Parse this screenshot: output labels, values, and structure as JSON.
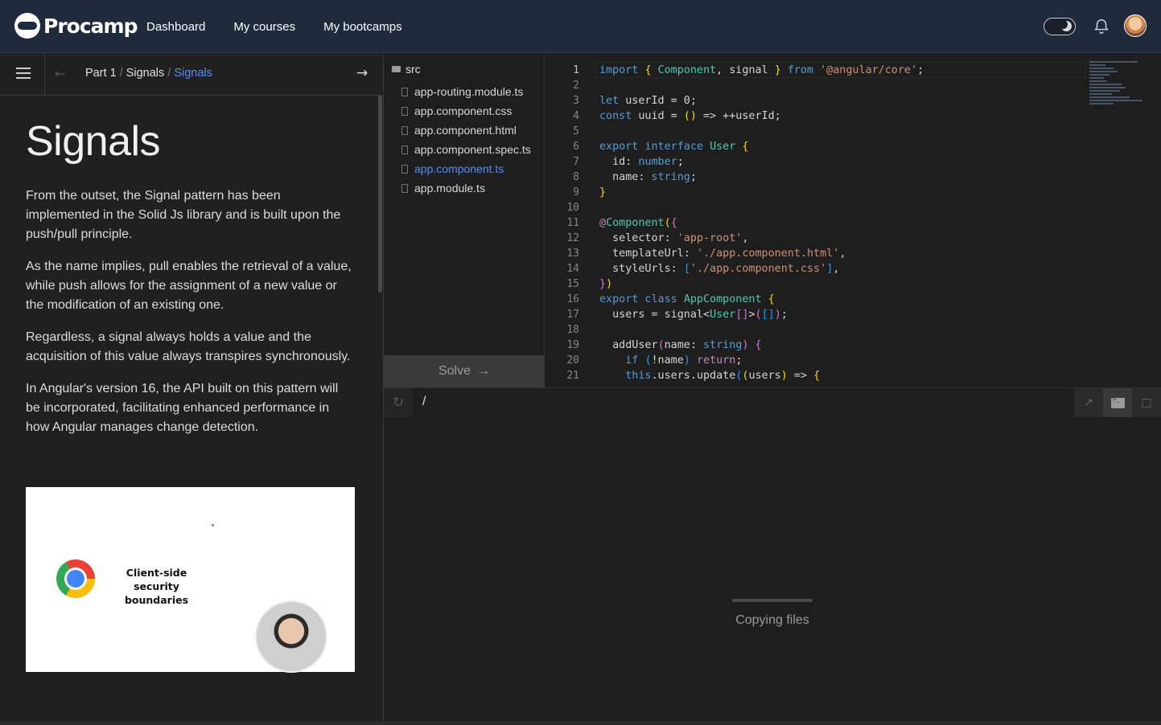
{
  "topnav": {
    "brand": "Procamp",
    "links": [
      "Dashboard",
      "My courses",
      "My bootcamps"
    ]
  },
  "lesson": {
    "breadcrumb": {
      "part": "Part 1",
      "section": "Signals",
      "current": "Signals"
    },
    "title": "Signals",
    "paragraphs": [
      "From the outset, the Signal pattern has been implemented in the Solid Js library and is built upon the push/pull principle.",
      "As the name implies, pull enables the retrieval of a value, while push allows for the assignment of a new value or the modification of an existing one.",
      "Regardless, a signal always holds a value and the acquisition of this value always transpires synchronously.",
      "In Angular's version 16, the API built on this pattern will be incorporated, facilitating enhanced performance in how Angular manages change detection."
    ],
    "video_caption": "Client-side security boundaries"
  },
  "files": {
    "folder": "src",
    "items": [
      "app-routing.module.ts",
      "app.component.css",
      "app.component.html",
      "app.component.spec.ts",
      "app.component.ts",
      "app.module.ts"
    ],
    "active_index": 4,
    "solve_label": "Solve"
  },
  "editor": {
    "line_numbers": [
      "1",
      "2",
      "3",
      "4",
      "5",
      "6",
      "7",
      "8",
      "9",
      "10",
      "11",
      "12",
      "13",
      "14",
      "15",
      "16",
      "17",
      "18",
      "19",
      "20",
      "21"
    ]
  },
  "preview": {
    "url": "/",
    "status": "Copying files"
  },
  "colors": {
    "accent": "#5a8df0",
    "nav_bg": "#1f2a3d",
    "pane_bg": "#1e1e1e"
  }
}
